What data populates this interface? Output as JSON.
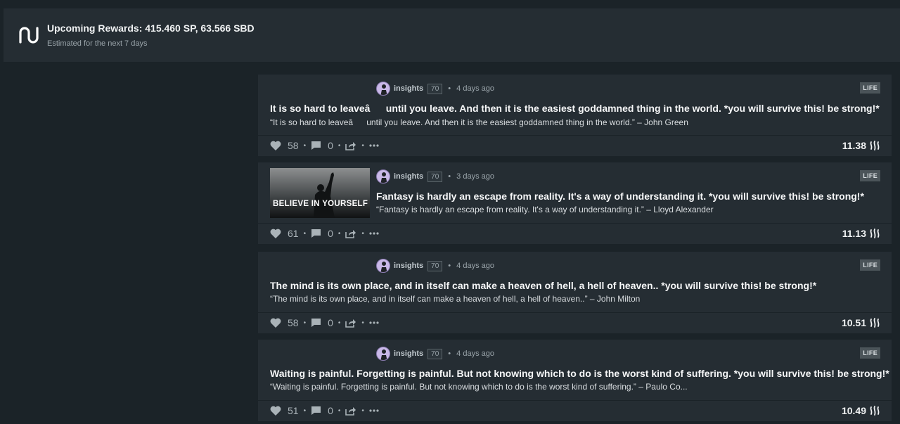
{
  "banner": {
    "title": "Upcoming Rewards: 415.460 SP, 63.566 SBD",
    "subtitle": "Estimated for the next 7 days"
  },
  "posts": [
    {
      "author": "insights",
      "reputation": "70",
      "time": "4 days ago",
      "tag": "LIFE",
      "title": "It is so hard to leaveâuntil you leave. And then it is the easiest goddamned thing in the world. *you will survive this! be strong!*",
      "body": "“It is so hard to leaveâuntil you leave. And then it is the easiest goddamned thing in the world.” – John Green",
      "votes": "58",
      "comments": "0",
      "payout": "11.38"
    },
    {
      "author": "insights",
      "reputation": "70",
      "time": "3 days ago",
      "tag": "LIFE",
      "thumbnail_text": "BELIEVE IN  YOURSELF",
      "title": "Fantasy is hardly an escape from reality. It's a way of understanding it. *you will survive this! be strong!*",
      "body": "“Fantasy is hardly an escape from reality. It's a way of understanding it.” – Lloyd Alexander",
      "votes": "61",
      "comments": "0",
      "payout": "11.13"
    },
    {
      "author": "insights",
      "reputation": "70",
      "time": "4 days ago",
      "tag": "LIFE",
      "title": "The mind is its own place, and in itself can make a heaven of hell, a hell of heaven.. *you will survive this! be strong!*",
      "body": "“The mind is its own place, and in itself can make a heaven of hell, a hell of heaven..” – John Milton",
      "votes": "58",
      "comments": "0",
      "payout": "10.51"
    },
    {
      "author": "insights",
      "reputation": "70",
      "time": "4 days ago",
      "tag": "LIFE",
      "title": "Waiting is painful. Forgetting is painful. But not knowing which to do is the worst kind of suffering. *you will survive this! be strong!*",
      "body": "“Waiting is painful. Forgetting is painful. But not knowing which to do is the worst kind of suffering.” – Paulo Co...",
      "votes": "51",
      "comments": "0",
      "payout": "10.49"
    }
  ],
  "icons": {
    "logo": "steem-logo-icon",
    "vote": "heart-icon",
    "comment": "comment-icon",
    "share": "share-icon",
    "more": "more-icon",
    "currency": "steem-icon"
  },
  "colors": {
    "background": "#1b2328",
    "card": "#252d33",
    "tag_bg": "#4b5459"
  }
}
